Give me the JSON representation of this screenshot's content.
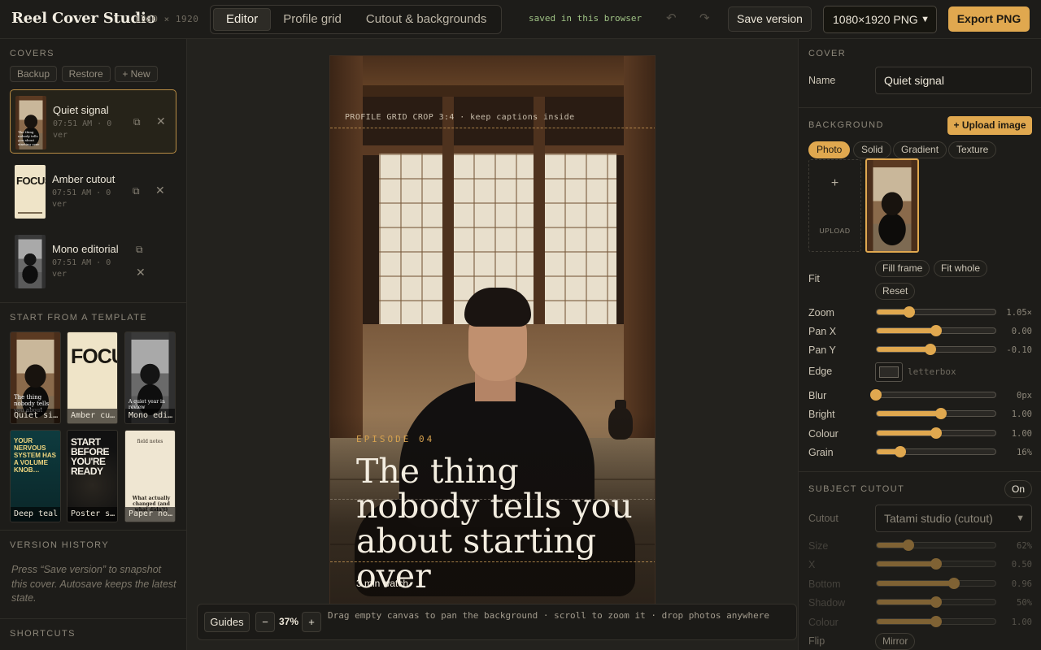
{
  "app": {
    "brand": "Reel Cover Studio",
    "dims": "1080 × 1920"
  },
  "tabs": [
    {
      "label": "Editor",
      "active": true
    },
    {
      "label": "Profile grid",
      "active": false
    },
    {
      "label": "Cutout & backgrounds",
      "active": false
    }
  ],
  "status": {
    "saved": "saved in this browser"
  },
  "toolbar": {
    "undo_icon": "↶",
    "redo_icon": "↷",
    "save_version": "Save version",
    "format": "1080×1920 PNG",
    "export": "Export PNG"
  },
  "covers": {
    "title": "Covers",
    "backup": "Backup",
    "restore": "Restore",
    "new": "+ New",
    "items": [
      {
        "name": "Quiet signal",
        "meta": "07:51 AM · 0 ver",
        "active": true
      },
      {
        "name": "Amber cutout",
        "meta": "07:51 AM · 0 ver",
        "thumb_text": "FOCUS",
        "active": false
      },
      {
        "name": "Mono editorial",
        "meta": "07:51 AM · 0 ver",
        "active": false
      }
    ]
  },
  "templates": {
    "title": "Start from a template",
    "items": [
      {
        "label": "Quiet si…",
        "text": "The thing nobody tells you about"
      },
      {
        "label": "Amber cu…",
        "text": "FOCUS"
      },
      {
        "label": "Mono edi…",
        "text": "A quiet year in review"
      },
      {
        "label": "Deep teal",
        "text": "YOUR NERVOUS SYSTEM HAS A VOLUME KNOB…"
      },
      {
        "label": "Poster s…",
        "text": "START BEFORE YOU'RE READY"
      },
      {
        "label": "Paper no…",
        "text": "What actually changed (and what didn't)",
        "top_text": "field notes"
      }
    ]
  },
  "history": {
    "title": "Version history",
    "empty": "Press “Save version” to snapshot this cover. Autosave keeps the latest state."
  },
  "shortcuts": {
    "title": "Shortcuts"
  },
  "canvas": {
    "grid_caption": "PROFILE GRID CROP 3:4 · keep captions inside",
    "episode": "EPISODE 04",
    "headline": "The thing nobody tells you about starting over",
    "watch": "3 min watch",
    "guides": "Guides",
    "zoom_minus": "−",
    "zoom": "37%",
    "zoom_plus": "+",
    "hint": "Drag empty canvas to pan the background · scroll to zoom it · drop photos anywhere"
  },
  "cover_panel": {
    "title": "Cover",
    "name_label": "Name",
    "name_value": "Quiet signal"
  },
  "background_panel": {
    "title": "Background",
    "upload": "+ Upload image",
    "chips": [
      "Photo",
      "Solid",
      "Gradient",
      "Texture"
    ],
    "upload_tile": "UPLOAD",
    "upload_plus": "+",
    "fit_label": "Fit",
    "fill_frame": "Fill frame",
    "fit_whole": "Fit whole",
    "reset": "Reset",
    "sliders": [
      {
        "label": "Zoom",
        "value": "1.05×",
        "fraction": 0.28
      },
      {
        "label": "Pan X",
        "value": "0.00",
        "fraction": 0.5
      },
      {
        "label": "Pan Y",
        "value": "-0.10",
        "fraction": 0.45
      },
      {
        "label": "Blur",
        "value": "0px",
        "fraction": 0.0
      },
      {
        "label": "Bright",
        "value": "1.00",
        "fraction": 0.54
      },
      {
        "label": "Colour",
        "value": "1.00",
        "fraction": 0.5
      },
      {
        "label": "Grain",
        "value": "16%",
        "fraction": 0.2
      }
    ],
    "edge_label": "Edge",
    "edge_value": "letterbox"
  },
  "cutout_panel": {
    "title": "Subject cutout",
    "on": "On",
    "cutout_label": "Cutout",
    "cutout_value": "Tatami studio (cutout)",
    "sliders": [
      {
        "label": "Size",
        "value": "62%",
        "fraction": 0.27
      },
      {
        "label": "X",
        "value": "0.50",
        "fraction": 0.5
      },
      {
        "label": "Bottom",
        "value": "0.96",
        "fraction": 0.65
      },
      {
        "label": "Shadow",
        "value": "50%",
        "fraction": 0.5
      },
      {
        "label": "Colour",
        "value": "1.00",
        "fraction": 0.5
      }
    ],
    "flip_label": "Flip",
    "mirror": "Mirror"
  },
  "colors": {
    "accent": "#e0a84f",
    "saved": "#9fc285",
    "background": "#1b1a17"
  }
}
